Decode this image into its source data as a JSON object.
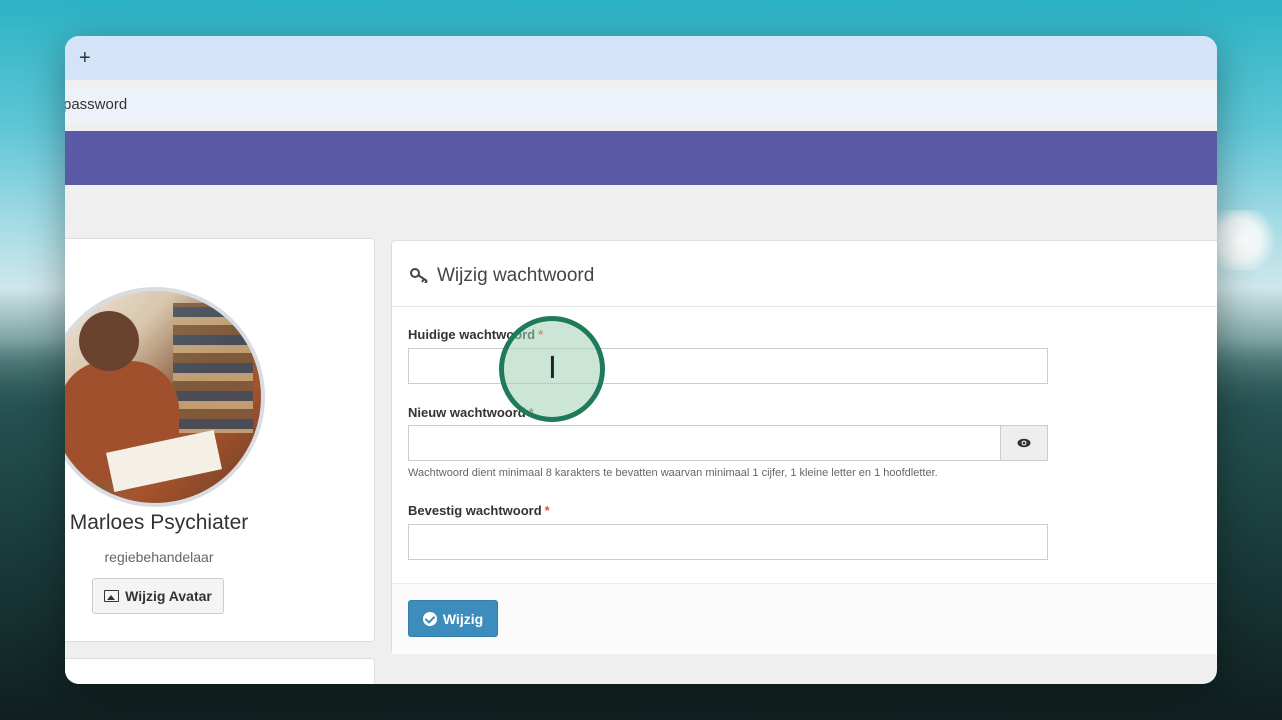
{
  "browser": {
    "new_tab_symbol": "+",
    "address_fragment": "password"
  },
  "profile": {
    "name": "Marloes Psychiater",
    "role": "regiebehandelaar",
    "change_avatar_label": "Wijzig Avatar"
  },
  "password_form": {
    "title": "Wijzig wachtwoord",
    "required_marker": "*",
    "current_label": "Huidige wachtwoord",
    "current_value": "",
    "new_label": "Nieuw wachtwoord",
    "new_value": "",
    "help_text": "Wachtwoord dient minimaal 8 karakters te bevatten waarvan minimaal 1 cijfer, 1 kleine letter en 1 hoofdletter.",
    "confirm_label": "Bevestig wachtwoord",
    "confirm_value": "",
    "submit_label": "Wijzig"
  },
  "colors": {
    "navbar": "#5b5aa6",
    "primary_button": "#3c8dbc",
    "required": "#d9534f",
    "cursor_ring": "#1f7a5a"
  },
  "icons": {
    "key": "key-icon",
    "eye": "eye-icon",
    "image": "image-icon",
    "check": "check-circle-icon",
    "cursor": "text-cursor-icon"
  }
}
